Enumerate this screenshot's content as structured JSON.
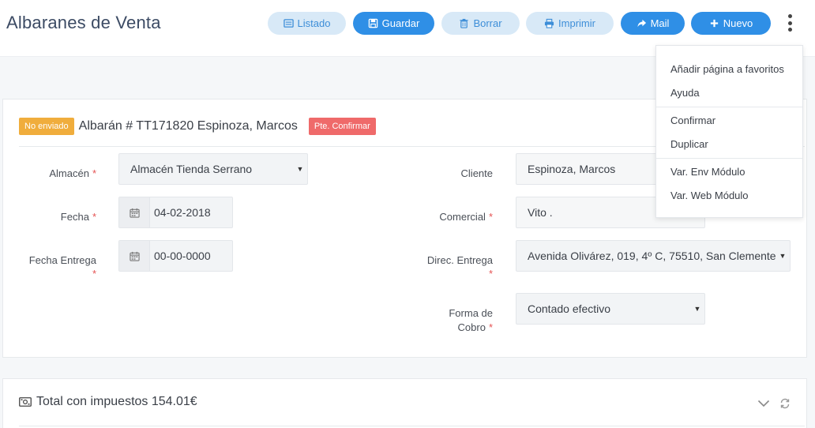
{
  "header": {
    "title": "Albaranes de Venta",
    "buttons": {
      "listado": "Listado",
      "guardar": "Guardar",
      "borrar": "Borrar",
      "imprimir": "Imprimir",
      "mail": "Mail",
      "nuevo": "Nuevo"
    }
  },
  "document": {
    "status_badge": "No enviado",
    "title": "Albarán # TT171820 Espinoza, Marcos",
    "state_badge": "Pte. Confirmar"
  },
  "form": {
    "almacen": {
      "label": "Almacén",
      "value": "Almacén Tienda Serrano"
    },
    "fecha": {
      "label": "Fecha",
      "value": "04-02-2018"
    },
    "fecha_entrega": {
      "label": "Fecha Entrega",
      "value": "00-00-0000"
    },
    "cliente": {
      "label": "Cliente",
      "value": "Espinoza, Marcos"
    },
    "comercial": {
      "label": "Comercial",
      "value": "Vito ."
    },
    "direc_entrega": {
      "label": "Direc. Entrega",
      "value": "Avenida Olivárez, 019, 4º C, 75510, San Clemente"
    },
    "forma_cobro": {
      "label_line1": "Forma de",
      "label_line2": "Cobro",
      "value": "Contado efectivo"
    }
  },
  "totals": {
    "label": "Total con impuestos 154.01€"
  },
  "menu": {
    "items": [
      "Añadir página a favoritos",
      "Ayuda",
      "Confirmar",
      "Duplicar",
      "Var. Env Módulo",
      "Var. Web Módulo"
    ]
  },
  "colors": {
    "primary": "#2f8fe6",
    "light_button": "#d8e9f7",
    "badge_orange": "#f0ad3c",
    "badge_red": "#ef6a6a",
    "required": "#e55353"
  },
  "icons": [
    "list-icon",
    "save-icon",
    "trash-icon",
    "print-icon",
    "share-icon",
    "plus-icon",
    "kebab-icon",
    "calendar-icon",
    "money-icon",
    "chevron-down-icon",
    "refresh-icon"
  ]
}
